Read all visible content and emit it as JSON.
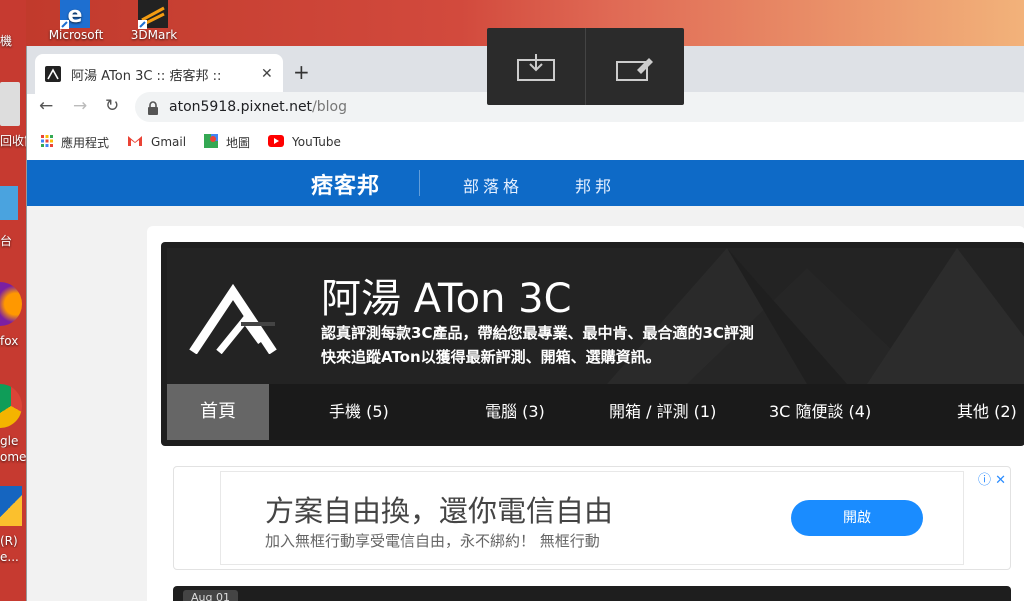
{
  "desktop": {
    "icons": [
      {
        "label": "Microsoft"
      },
      {
        "label": "3DMark"
      }
    ],
    "left_labels": [
      "機",
      "回收筒",
      "台",
      "fox",
      "gle",
      "ome",
      "(R)",
      "e..."
    ]
  },
  "capture_toolbar": {
    "buttons": [
      "screenshot-download-icon",
      "pin-edit-icon"
    ]
  },
  "browser": {
    "tab": {
      "title": "阿湯 ATon 3C :: 痞客邦 ::",
      "close": "✕"
    },
    "new_tab": "+",
    "nav": {
      "back": "←",
      "forward": "→",
      "reload": "↻"
    },
    "url": {
      "host": "aton5918.pixnet.net",
      "path": "/blog"
    },
    "bookmarks": [
      {
        "label": "應用程式",
        "icon": "apps-grid-icon"
      },
      {
        "label": "Gmail",
        "icon": "gmail-icon"
      },
      {
        "label": "地圖",
        "icon": "maps-icon"
      },
      {
        "label": "YouTube",
        "icon": "youtube-icon"
      }
    ]
  },
  "pixnet": {
    "logo": "痞客邦",
    "links": [
      "部落格",
      "邦邦"
    ],
    "brand_color": "#0e6ac7"
  },
  "blog": {
    "title": "阿湯 ATon 3C",
    "desc1": "認真評測每款3C產品，帶給您最專業、最中肯、最合適的3C評測",
    "desc2": "快來追蹤ATon以獲得最新評測、開箱、選購資訊。",
    "menu": [
      {
        "label": "首頁",
        "active": true
      },
      {
        "label": "手機 (5)"
      },
      {
        "label": "電腦 (3)"
      },
      {
        "label": "開箱 / 評測 (1)"
      },
      {
        "label": "3C 隨便談 (4)"
      },
      {
        "label": "其他 (2)"
      }
    ]
  },
  "ad": {
    "title": "方案自由換，還你電信自由",
    "subtitle": "加入無框行動享受電信自由，永不綁約！ 無框行動",
    "button": "開啟",
    "close": "ⓘ ✕"
  },
  "post": {
    "date": "Aug 01"
  }
}
